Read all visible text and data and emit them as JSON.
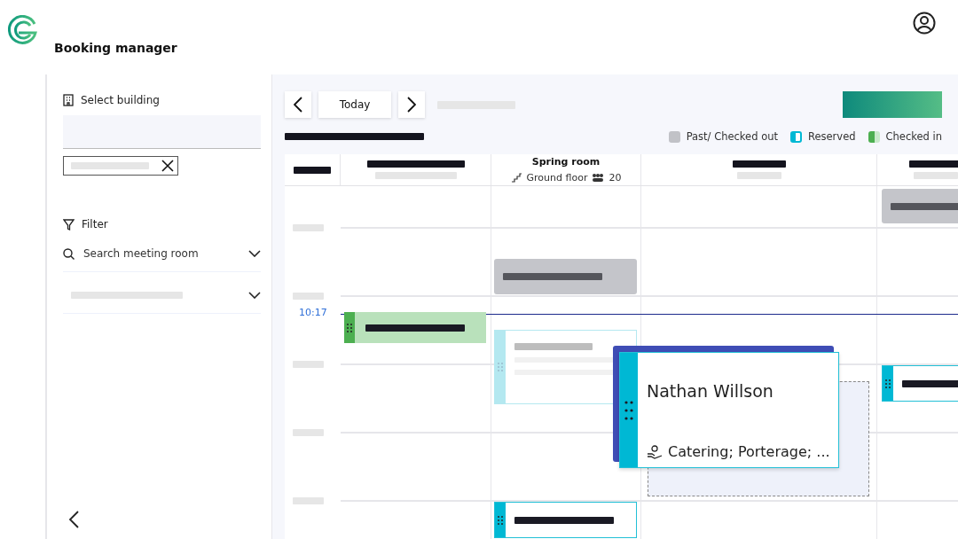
{
  "app": {
    "title": "Booking manager"
  },
  "sidebar": {
    "building_label": "Select building",
    "filter_label": "Filter",
    "search": {
      "placeholder": "Search meeting room"
    }
  },
  "toolbar": {
    "today": "Today"
  },
  "legend": [
    {
      "label": "Past/ Checked out",
      "kind": "past"
    },
    {
      "label": "Reserved",
      "kind": "reserved"
    },
    {
      "label": "Checked in",
      "kind": "checked_in"
    }
  ],
  "rooms": [
    {
      "kind": "redacted"
    },
    {
      "kind": "named",
      "name": "Spring room",
      "floor": "Ground floor",
      "capacity": "20"
    },
    {
      "kind": "redacted"
    },
    {
      "kind": "redacted"
    }
  ],
  "now_time": "10:17",
  "bookings": [
    {
      "kind": "past"
    },
    {
      "kind": "past"
    },
    {
      "kind": "checked_in"
    },
    {
      "kind": "ghost"
    },
    {
      "kind": "reserved"
    },
    {
      "kind": "reserved"
    },
    {
      "kind": "dragging",
      "name": "Nathan Willson",
      "services": "Catering; Porterage; ..."
    }
  ]
}
